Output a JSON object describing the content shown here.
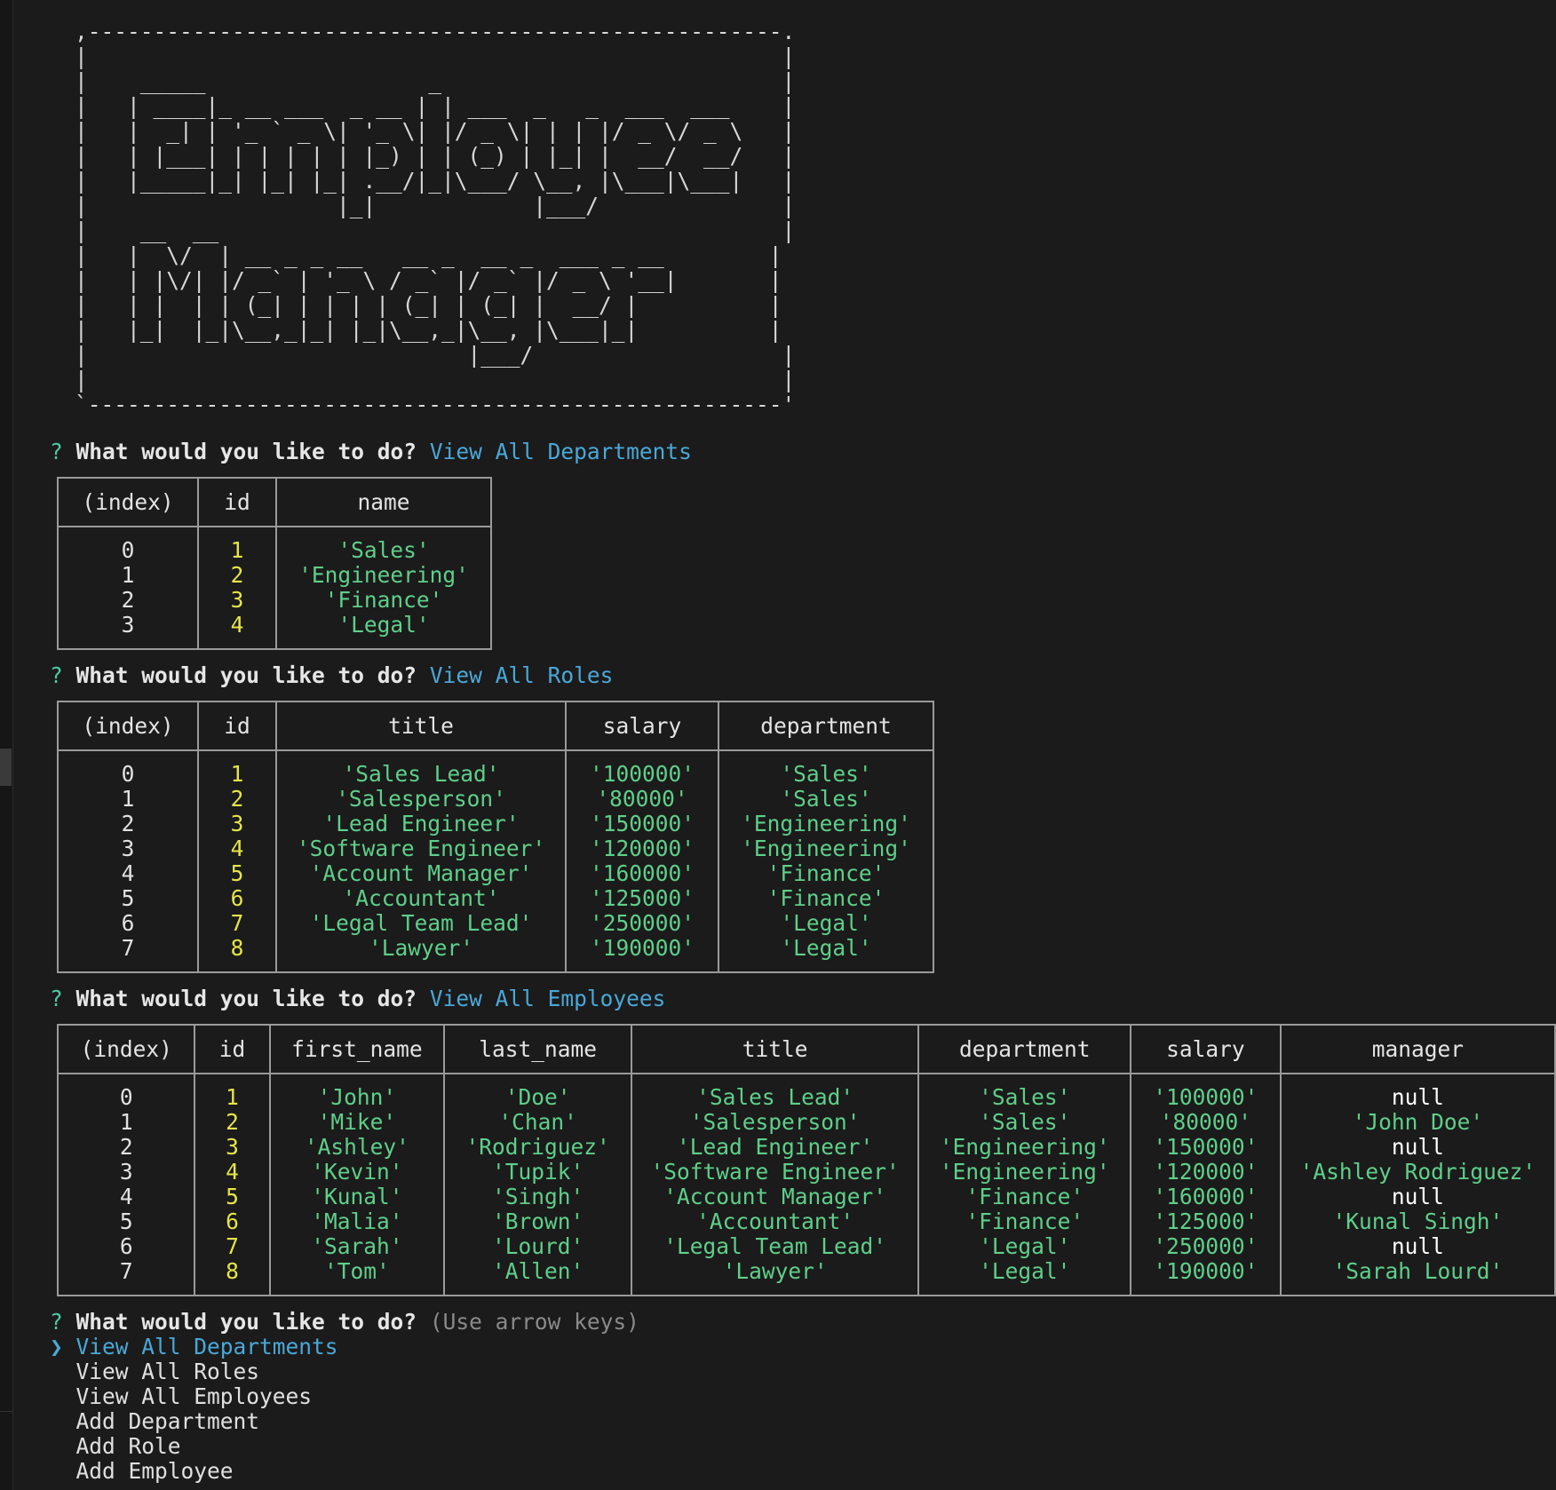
{
  "banner": {
    "art": ",-----------------------------------------------------.\n|                                                     |\n|    _____                 _                          |\n|   | ____|_ __ ___  _ __ | | ___  _   _  ___  ___    |\n|   |  _| | '_ ` _ \\| '_ \\| |/ _ \\| | | |/ _ \\/ _ \\   |\n|   | |___| | | | | | |_) | | (_) | |_| |  __/  __/   |\n|   |_____|_| |_| |_| .__/|_|\\___/ \\__, |\\___|\\___|   |\n|                   |_|            |___/              |\n|    __  __                                           |\n|   |  \\/  | __ _ _ __   __ _  __ _  ___ _ __        |\n|   | |\\/| |/ _` | '_ \\ / _` |/ _` |/ _ \\ '__|       |\n|   | |  | | (_| | | | | (_| | (_| |  __/ |          |\n|   |_|  |_|\\__,_|_| |_|\\__,_|\\__, |\\___|_|          |\n|                             |___/                   |\n|                                                     |\n`-----------------------------------------------------'"
  },
  "prompt": {
    "qmark": "?",
    "question": "What would you like to do?"
  },
  "departments_block": {
    "answer": "View All Departments",
    "headers": [
      "(index)",
      "id",
      "name"
    ],
    "rows": [
      [
        "0",
        "1",
        "'Sales'"
      ],
      [
        "1",
        "2",
        "'Engineering'"
      ],
      [
        "2",
        "3",
        "'Finance'"
      ],
      [
        "3",
        "4",
        "'Legal'"
      ]
    ]
  },
  "roles_block": {
    "answer": "View All Roles",
    "headers": [
      "(index)",
      "id",
      "title",
      "salary",
      "department"
    ],
    "rows": [
      [
        "0",
        "1",
        "'Sales Lead'",
        "'100000'",
        "'Sales'"
      ],
      [
        "1",
        "2",
        "'Salesperson'",
        "'80000'",
        "'Sales'"
      ],
      [
        "2",
        "3",
        "'Lead Engineer'",
        "'150000'",
        "'Engineering'"
      ],
      [
        "3",
        "4",
        "'Software Engineer'",
        "'120000'",
        "'Engineering'"
      ],
      [
        "4",
        "5",
        "'Account Manager'",
        "'160000'",
        "'Finance'"
      ],
      [
        "5",
        "6",
        "'Accountant'",
        "'125000'",
        "'Finance'"
      ],
      [
        "6",
        "7",
        "'Legal Team Lead'",
        "'250000'",
        "'Legal'"
      ],
      [
        "7",
        "8",
        "'Lawyer'",
        "'190000'",
        "'Legal'"
      ]
    ]
  },
  "employees_block": {
    "answer": "View All Employees",
    "headers": [
      "(index)",
      "id",
      "first_name",
      "last_name",
      "title",
      "department",
      "salary",
      "manager"
    ],
    "rows": [
      [
        "0",
        "1",
        "'John'",
        "'Doe'",
        "'Sales Lead'",
        "'Sales'",
        "'100000'",
        "null"
      ],
      [
        "1",
        "2",
        "'Mike'",
        "'Chan'",
        "'Salesperson'",
        "'Sales'",
        "'80000'",
        "'John Doe'"
      ],
      [
        "2",
        "3",
        "'Ashley'",
        "'Rodriguez'",
        "'Lead Engineer'",
        "'Engineering'",
        "'150000'",
        "null"
      ],
      [
        "3",
        "4",
        "'Kevin'",
        "'Tupik'",
        "'Software Engineer'",
        "'Engineering'",
        "'120000'",
        "'Ashley Rodriguez'"
      ],
      [
        "4",
        "5",
        "'Kunal'",
        "'Singh'",
        "'Account Manager'",
        "'Finance'",
        "'160000'",
        "null"
      ],
      [
        "5",
        "6",
        "'Malia'",
        "'Brown'",
        "'Accountant'",
        "'Finance'",
        "'125000'",
        "'Kunal Singh'"
      ],
      [
        "6",
        "7",
        "'Sarah'",
        "'Lourd'",
        "'Legal Team Lead'",
        "'Legal'",
        "'250000'",
        "null"
      ],
      [
        "7",
        "8",
        "'Tom'",
        "'Allen'",
        "'Lawyer'",
        "'Legal'",
        "'190000'",
        "'Sarah Lourd'"
      ]
    ]
  },
  "menu": {
    "hint": "(Use arrow keys)",
    "pointer": "❯",
    "choices": [
      "View All Departments",
      "View All Roles",
      "View All Employees",
      "Add Department",
      "Add Role",
      "Add Employee"
    ]
  },
  "colors": {
    "background": "#1b1b1b",
    "qmark": "#4ec9a5",
    "answer": "#4aa8d8",
    "id_yellow": "#e5e54a",
    "string_green": "#5fcf8a",
    "border": "#9a9a9a"
  }
}
